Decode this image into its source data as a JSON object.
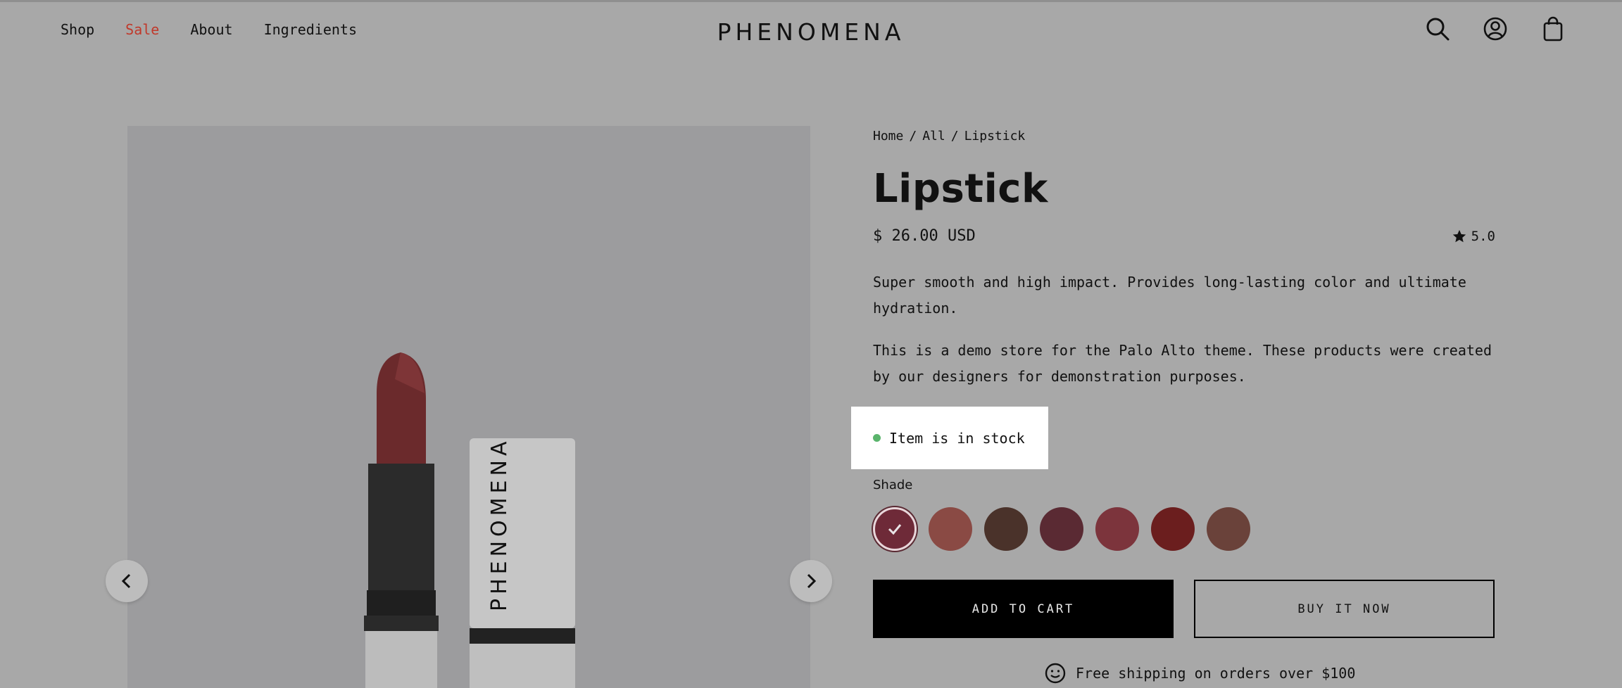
{
  "header": {
    "nav": [
      "Shop",
      "Sale",
      "About",
      "Ingredients"
    ],
    "brand": "PHENOMENA",
    "icons": [
      "search-icon",
      "account-icon",
      "bag-icon"
    ]
  },
  "gallery": {
    "product_image_text": "PHENOMENA",
    "prev_icon": "chevron-left-icon",
    "next_icon": "chevron-right-icon"
  },
  "product": {
    "breadcrumb": [
      "Home",
      "All",
      "Lipstick"
    ],
    "breadcrumb_sep": "/",
    "title": "Lipstick",
    "price": "$ 26.00 USD",
    "rating": "5.0",
    "description": [
      "Super smooth and high impact. Provides long-lasting color and ultimate hydration.",
      "This is a demo store for the Palo Alto theme. These products were created by our designers for demonstration purposes."
    ],
    "stock": "Item is in stock",
    "stock_color": "#5ab46c",
    "shade_label": "Shade",
    "shades": [
      "#6e2a38",
      "#8a4a44",
      "#4a322a",
      "#5a2a33",
      "#7c343c",
      "#6b1e1e",
      "#6a423a"
    ],
    "selected_shade": 0,
    "add_to_cart": "ADD TO CART",
    "buy_now": "BUY IT NOW",
    "shipping": "Free shipping on orders over $100"
  }
}
